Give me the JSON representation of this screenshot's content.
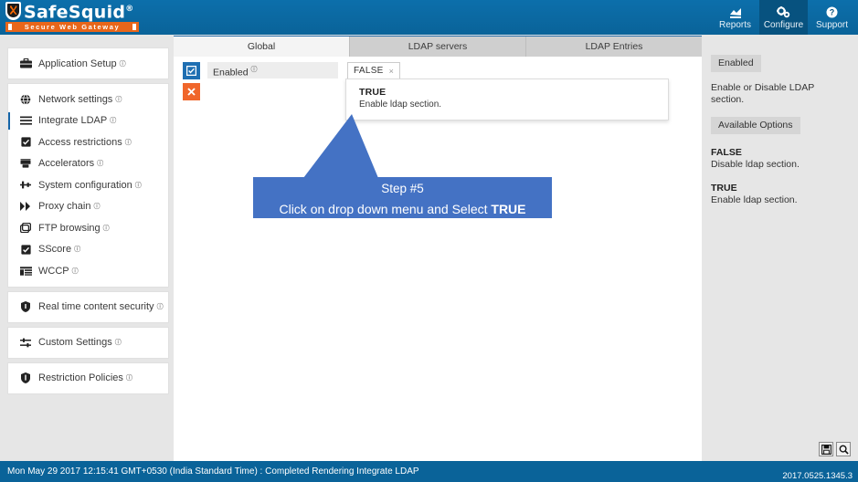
{
  "brand": {
    "name": "SafeSquid",
    "registered": "®",
    "tagline": "Secure Web Gateway"
  },
  "topnav": [
    {
      "label": "Reports",
      "icon": "chart-icon",
      "active": false
    },
    {
      "label": "Configure",
      "icon": "gears-icon",
      "active": true
    },
    {
      "label": "Support",
      "icon": "help-icon",
      "active": false
    }
  ],
  "sidebar": {
    "groups": [
      {
        "items": [
          {
            "label": "Application Setup",
            "icon": "briefcase-icon",
            "active": false,
            "help": "ⓘ"
          }
        ]
      },
      {
        "items": [
          {
            "label": "Network settings",
            "icon": "globe-icon",
            "active": false,
            "help": "ⓘ"
          },
          {
            "label": "Integrate LDAP",
            "icon": "list-icon",
            "active": true,
            "help": "ⓘ"
          },
          {
            "label": "Access restrictions",
            "icon": "checkbox-icon",
            "active": false,
            "help": "ⓘ"
          },
          {
            "label": "Accelerators",
            "icon": "server-icon",
            "active": false,
            "help": "ⓘ"
          },
          {
            "label": "System configuration",
            "icon": "sliders-icon",
            "active": false,
            "help": "ⓘ"
          },
          {
            "label": "Proxy chain",
            "icon": "forward-icon",
            "active": false,
            "help": "ⓘ"
          },
          {
            "label": "FTP browsing",
            "icon": "files-icon",
            "active": false,
            "help": "ⓘ"
          },
          {
            "label": "SScore",
            "icon": "checkbox-icon",
            "active": false,
            "help": "ⓘ"
          },
          {
            "label": "WCCP",
            "icon": "table-icon",
            "active": false,
            "help": "ⓘ"
          }
        ]
      },
      {
        "items": [
          {
            "label": "Real time content security",
            "icon": "shield-icon",
            "active": false,
            "help": "ⓘ"
          }
        ]
      },
      {
        "items": [
          {
            "label": "Custom Settings",
            "icon": "sliders-icon",
            "active": false,
            "help": "ⓘ"
          }
        ]
      },
      {
        "items": [
          {
            "label": "Restriction Policies",
            "icon": "badge-shield-icon",
            "active": false,
            "help": "ⓘ"
          }
        ]
      }
    ]
  },
  "tabs": [
    {
      "label": "Global",
      "active": true
    },
    {
      "label": "LDAP servers",
      "active": false
    },
    {
      "label": "LDAP Entries",
      "active": false
    }
  ],
  "form": {
    "row_toggle_icon": "checkbox-checked-icon",
    "row_delete_icon": "close-x-icon",
    "field_label": "Enabled",
    "field_help": "ⓘ",
    "selected_value": "FALSE",
    "tag_remove": "×",
    "suggestion": {
      "title": "TRUE",
      "description": "Enable ldap section."
    }
  },
  "callout": {
    "line1": "Step #5",
    "line2_prefix": "Click on drop down menu and Select ",
    "line2_bold": "TRUE",
    "color": "#4472c4"
  },
  "right_panel": {
    "title_badge": "Enabled",
    "description": "Enable or Disable LDAP section.",
    "options_badge": "Available Options",
    "options": [
      {
        "name": "FALSE",
        "description": "Disable ldap section."
      },
      {
        "name": "TRUE",
        "description": "Enable ldap section."
      }
    ]
  },
  "statusbar": {
    "message": "Mon May 29 2017 12:15:41 GMT+0530 (India Standard Time) : Completed Rendering Integrate LDAP",
    "version": "2017.0525.1345.3",
    "buttons": [
      {
        "icon": "save-icon"
      },
      {
        "icon": "search-icon"
      }
    ]
  },
  "theme": {
    "header_blue": "#0a6399",
    "accent_orange": "#f0662b",
    "callout_blue": "#4472c4",
    "panel_gray": "#e6e6e6"
  }
}
